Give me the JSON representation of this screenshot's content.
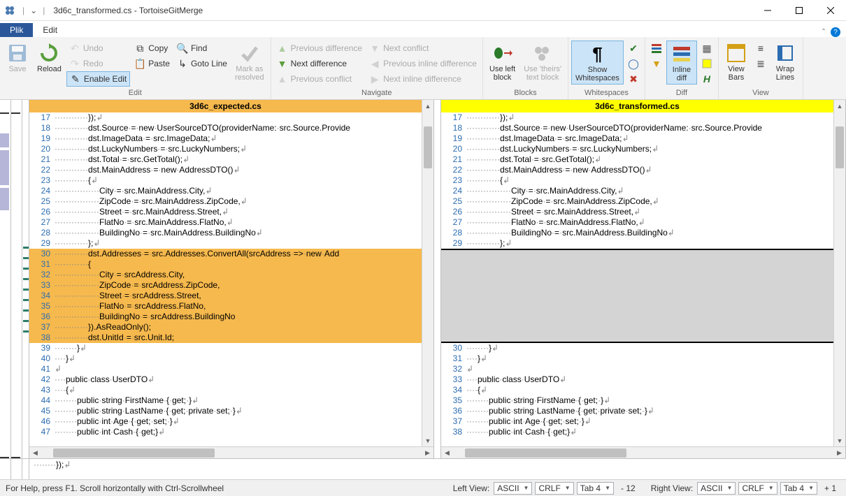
{
  "window": {
    "title": "3d6c_transformed.cs - TortoiseGitMerge"
  },
  "tabs": {
    "plik": "Plik",
    "edit": "Edit"
  },
  "ribbon": {
    "main": {
      "save": "Save",
      "reload": "Reload",
      "undo": "Undo",
      "redo": "Redo",
      "enable_edit": "Enable Edit",
      "copy": "Copy",
      "paste": "Paste",
      "find": "Find",
      "goto": "Goto Line",
      "mark_resolved": "Mark as\nresolved",
      "group_label": "Edit"
    },
    "navigate": {
      "prev_diff": "Previous difference",
      "next_diff": "Next difference",
      "prev_conflict": "Previous conflict",
      "next_conflict": "Next conflict",
      "prev_inline": "Previous inline difference",
      "next_inline": "Next inline difference",
      "group_label": "Navigate"
    },
    "blocks": {
      "use_left": "Use left\nblock",
      "use_theirs": "Use 'theirs'\ntext block",
      "group_label": "Blocks"
    },
    "whitespaces": {
      "show_ws": "Show\nWhitespaces",
      "group_label": "Whitespaces"
    },
    "diff": {
      "inline_diff": "Inline\ndiff",
      "group_label": "Diff"
    },
    "view": {
      "view_bars": "View\nBars",
      "wrap_lines": "Wrap\nLines",
      "group_label": "View"
    }
  },
  "panes": {
    "left_title": "3d6c_expected.cs",
    "right_title": "3d6c_transformed.cs"
  },
  "code_left": [
    {
      "n": 17,
      "t": "············});↲"
    },
    {
      "n": 18,
      "t": "············dst.Source·=·new·UserSourceDTO(providerName:·src.Source.Provide"
    },
    {
      "n": 19,
      "t": "············dst.ImageData·=·src.ImageData;↲"
    },
    {
      "n": 20,
      "t": "············dst.LuckyNumbers·=·src.LuckyNumbers;↲"
    },
    {
      "n": 21,
      "t": "············dst.Total·=·src.GetTotal();↲"
    },
    {
      "n": 22,
      "t": "············dst.MainAddress·=·new·AddressDTO()↲"
    },
    {
      "n": 23,
      "t": "············{↲"
    },
    {
      "n": 24,
      "t": "················City·=·src.MainAddress.City,↲"
    },
    {
      "n": 25,
      "t": "················ZipCode·=·src.MainAddress.ZipCode,↲"
    },
    {
      "n": 26,
      "t": "················Street·=·src.MainAddress.Street,↲"
    },
    {
      "n": 27,
      "t": "················FlatNo·=·src.MainAddress.FlatNo,↲"
    },
    {
      "n": 28,
      "t": "················BuildingNo·=·src.MainAddress.BuildingNo↲"
    },
    {
      "n": 29,
      "t": "············};↲"
    },
    {
      "n": 30,
      "t": "············dst.Addresses·=·src.Addresses.ConvertAll(srcAddress·=>·new·Add",
      "hl": true
    },
    {
      "n": 31,
      "t": "············{",
      "hl": true
    },
    {
      "n": 32,
      "t": "················City·=·srcAddress.City,",
      "hl": true
    },
    {
      "n": 33,
      "t": "················ZipCode·=·srcAddress.ZipCode,",
      "hl": true
    },
    {
      "n": 34,
      "t": "················Street·=·srcAddress.Street,",
      "hl": true
    },
    {
      "n": 35,
      "t": "················FlatNo·=·srcAddress.FlatNo,",
      "hl": true
    },
    {
      "n": 36,
      "t": "················BuildingNo·=·srcAddress.BuildingNo",
      "hl": true
    },
    {
      "n": 37,
      "t": "············}).AsReadOnly();",
      "hl": true
    },
    {
      "n": 38,
      "t": "············dst.UnitId·=·src.Unit.Id;",
      "hl": true
    },
    {
      "n": 39,
      "t": "········}↲"
    },
    {
      "n": 40,
      "t": "····}↲"
    },
    {
      "n": 41,
      "t": "↲"
    },
    {
      "n": 42,
      "t": "····public·class·UserDTO↲"
    },
    {
      "n": 43,
      "t": "····{↲"
    },
    {
      "n": 44,
      "t": "········public·string·FirstName·{·get;·}↲"
    },
    {
      "n": 45,
      "t": "········public·string·LastName·{·get;·private·set;·}↲"
    },
    {
      "n": 46,
      "t": "········public·int·Age·{·get;·set;·}↲"
    },
    {
      "n": 47,
      "t": "········public·int·Cash·{·get;}↲"
    }
  ],
  "code_right_top": [
    {
      "n": 17,
      "t": "············});↲"
    },
    {
      "n": 18,
      "t": "············dst.Source·=·new·UserSourceDTO(providerName:·src.Source.Provide"
    },
    {
      "n": 19,
      "t": "············dst.ImageData·=·src.ImageData;↲"
    },
    {
      "n": 20,
      "t": "············dst.LuckyNumbers·=·src.LuckyNumbers;↲"
    },
    {
      "n": 21,
      "t": "············dst.Total·=·src.GetTotal();↲"
    },
    {
      "n": 22,
      "t": "············dst.MainAddress·=·new·AddressDTO()↲"
    },
    {
      "n": 23,
      "t": "············{↲"
    },
    {
      "n": 24,
      "t": "················City·=·src.MainAddress.City,↲"
    },
    {
      "n": 25,
      "t": "················ZipCode·=·src.MainAddress.ZipCode,↲"
    },
    {
      "n": 26,
      "t": "················Street·=·src.MainAddress.Street,↲"
    },
    {
      "n": 27,
      "t": "················FlatNo·=·src.MainAddress.FlatNo,↲"
    },
    {
      "n": 28,
      "t": "················BuildingNo·=·src.MainAddress.BuildingNo↲"
    },
    {
      "n": 29,
      "t": "············};↲"
    }
  ],
  "code_right_bottom": [
    {
      "n": 30,
      "t": "········}↲"
    },
    {
      "n": 31,
      "t": "····}↲"
    },
    {
      "n": 32,
      "t": "↲"
    },
    {
      "n": 33,
      "t": "····public·class·UserDTO↲"
    },
    {
      "n": 34,
      "t": "····{↲"
    },
    {
      "n": 35,
      "t": "········public·string·FirstName·{·get;·}↲"
    },
    {
      "n": 36,
      "t": "········public·string·LastName·{·get;·private·set;·}↲"
    },
    {
      "n": 37,
      "t": "········public·int·Age·{·get;·set;·}↲"
    },
    {
      "n": 38,
      "t": "········public·int·Cash·{·get;}↲"
    }
  ],
  "bottom_line": "········});↲",
  "status": {
    "help": "For Help, press F1. Scroll horizontally with Ctrl-Scrollwheel",
    "left_view": "Left View:",
    "right_view": "Right View:",
    "enc": "ASCII",
    "eol": "CRLF",
    "tab": "Tab 4",
    "left_diff": "- 12",
    "right_diff": "+ 1"
  }
}
